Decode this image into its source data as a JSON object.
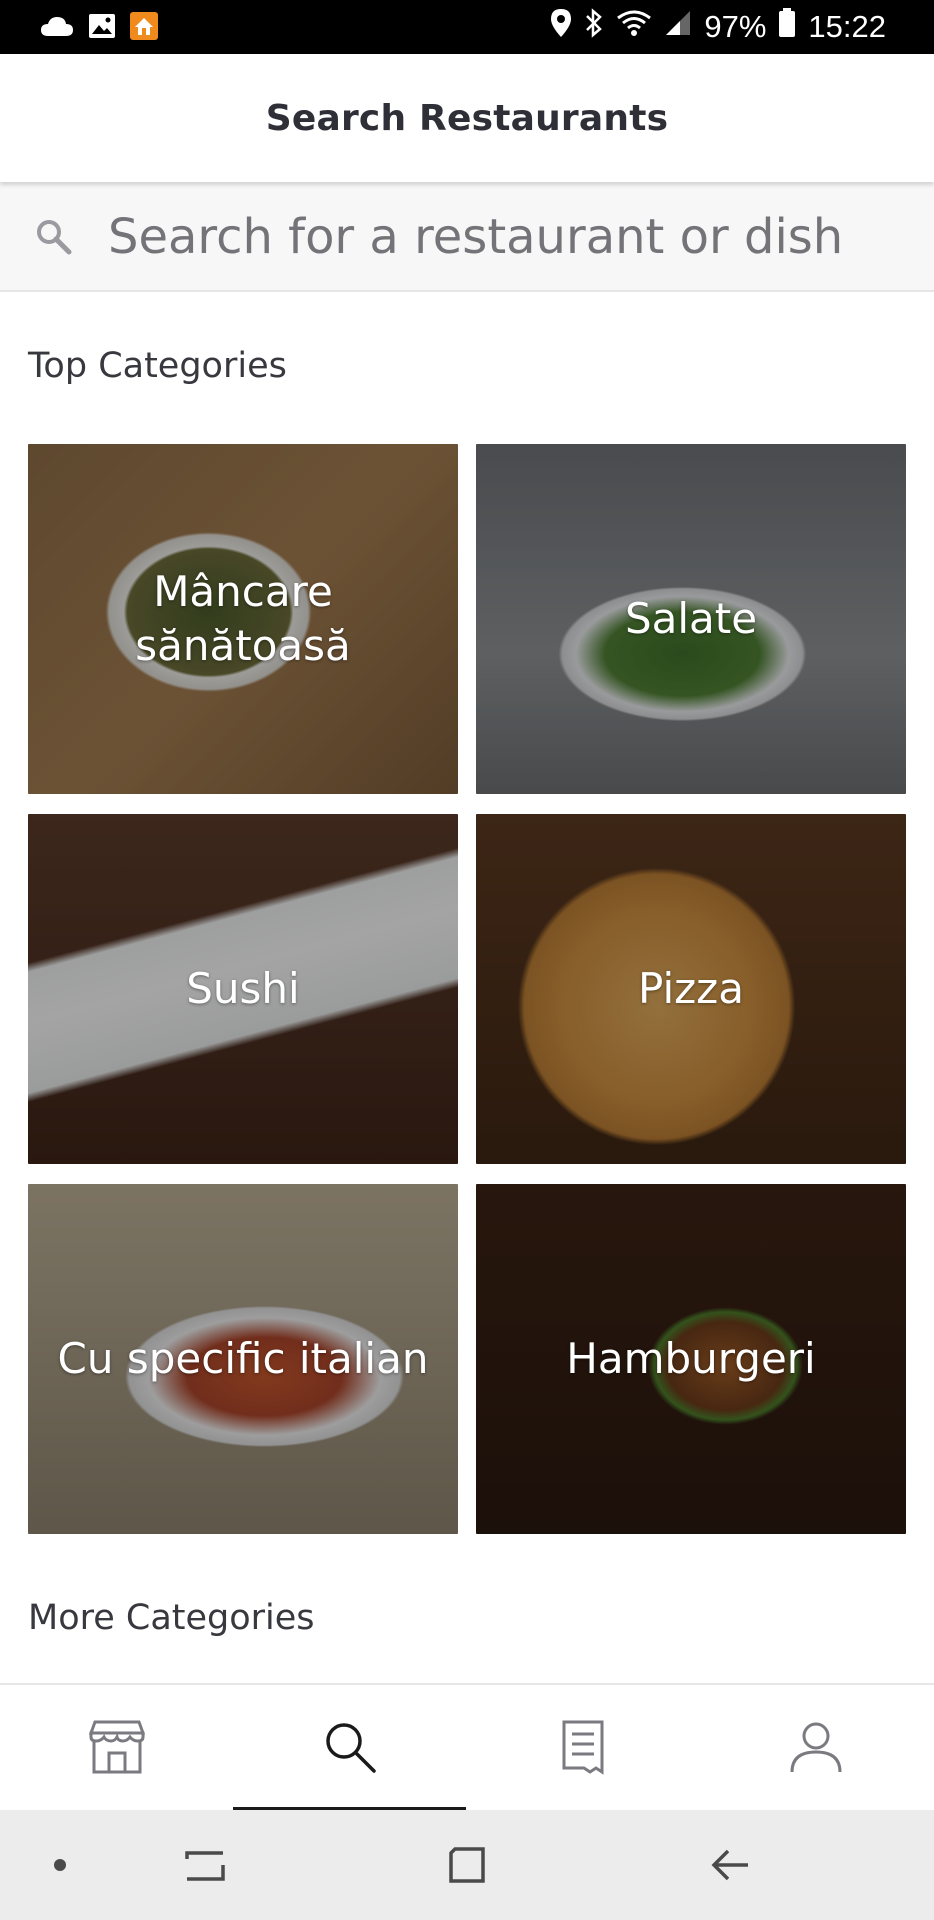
{
  "status_bar": {
    "battery": "97%",
    "time": "15:22",
    "icons_left": [
      "cloud-icon",
      "image-icon",
      "home-app-icon"
    ],
    "icons_right": [
      "location-icon",
      "bluetooth-icon",
      "wifi-icon",
      "signal-icon",
      "battery-icon"
    ]
  },
  "header": {
    "title": "Search Restaurants"
  },
  "search": {
    "placeholder": "Search for a restaurant or dish",
    "value": ""
  },
  "sections": {
    "top_categories": "Top Categories",
    "more_categories": "More Categories"
  },
  "categories": [
    {
      "label": "Mâncare sănătoasă"
    },
    {
      "label": "Salate"
    },
    {
      "label": "Sushi"
    },
    {
      "label": "Pizza"
    },
    {
      "label": "Cu specific italian"
    },
    {
      "label": "Hamburgeri"
    }
  ],
  "bottom_nav": {
    "items": [
      {
        "icon": "store-icon"
      },
      {
        "icon": "search-icon",
        "active": true
      },
      {
        "icon": "receipt-icon"
      },
      {
        "icon": "account-icon"
      }
    ]
  },
  "system_nav": [
    "dot-icon",
    "recents-icon",
    "home-icon",
    "back-icon"
  ],
  "colors": {
    "accent": "#1a1a1a",
    "header_bg": "#ffffff",
    "search_bg": "#f7f7f7",
    "system_nav_bg": "#ececec"
  }
}
